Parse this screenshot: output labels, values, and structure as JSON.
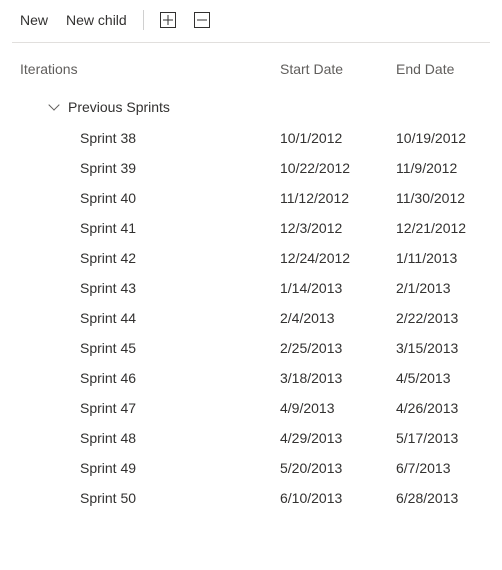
{
  "toolbar": {
    "new_label": "New",
    "new_child_label": "New child",
    "expand_all_title": "Expand all",
    "collapse_all_title": "Collapse all"
  },
  "columns": {
    "iterations": "Iterations",
    "start_date": "Start Date",
    "end_date": "End Date"
  },
  "group": {
    "label": "Previous Sprints",
    "expanded": true
  },
  "rows": [
    {
      "name": "Sprint 38",
      "start": "10/1/2012",
      "end": "10/19/2012"
    },
    {
      "name": "Sprint 39",
      "start": "10/22/2012",
      "end": "11/9/2012"
    },
    {
      "name": "Sprint 40",
      "start": "11/12/2012",
      "end": "11/30/2012"
    },
    {
      "name": "Sprint 41",
      "start": "12/3/2012",
      "end": "12/21/2012"
    },
    {
      "name": "Sprint 42",
      "start": "12/24/2012",
      "end": "1/11/2013"
    },
    {
      "name": "Sprint 43",
      "start": "1/14/2013",
      "end": "2/1/2013"
    },
    {
      "name": "Sprint 44",
      "start": "2/4/2013",
      "end": "2/22/2013"
    },
    {
      "name": "Sprint 45",
      "start": "2/25/2013",
      "end": "3/15/2013"
    },
    {
      "name": "Sprint 46",
      "start": "3/18/2013",
      "end": "4/5/2013"
    },
    {
      "name": "Sprint 47",
      "start": "4/9/2013",
      "end": "4/26/2013"
    },
    {
      "name": "Sprint 48",
      "start": "4/29/2013",
      "end": "5/17/2013"
    },
    {
      "name": "Sprint 49",
      "start": "5/20/2013",
      "end": "6/7/2013"
    },
    {
      "name": "Sprint 50",
      "start": "6/10/2013",
      "end": "6/28/2013"
    }
  ]
}
